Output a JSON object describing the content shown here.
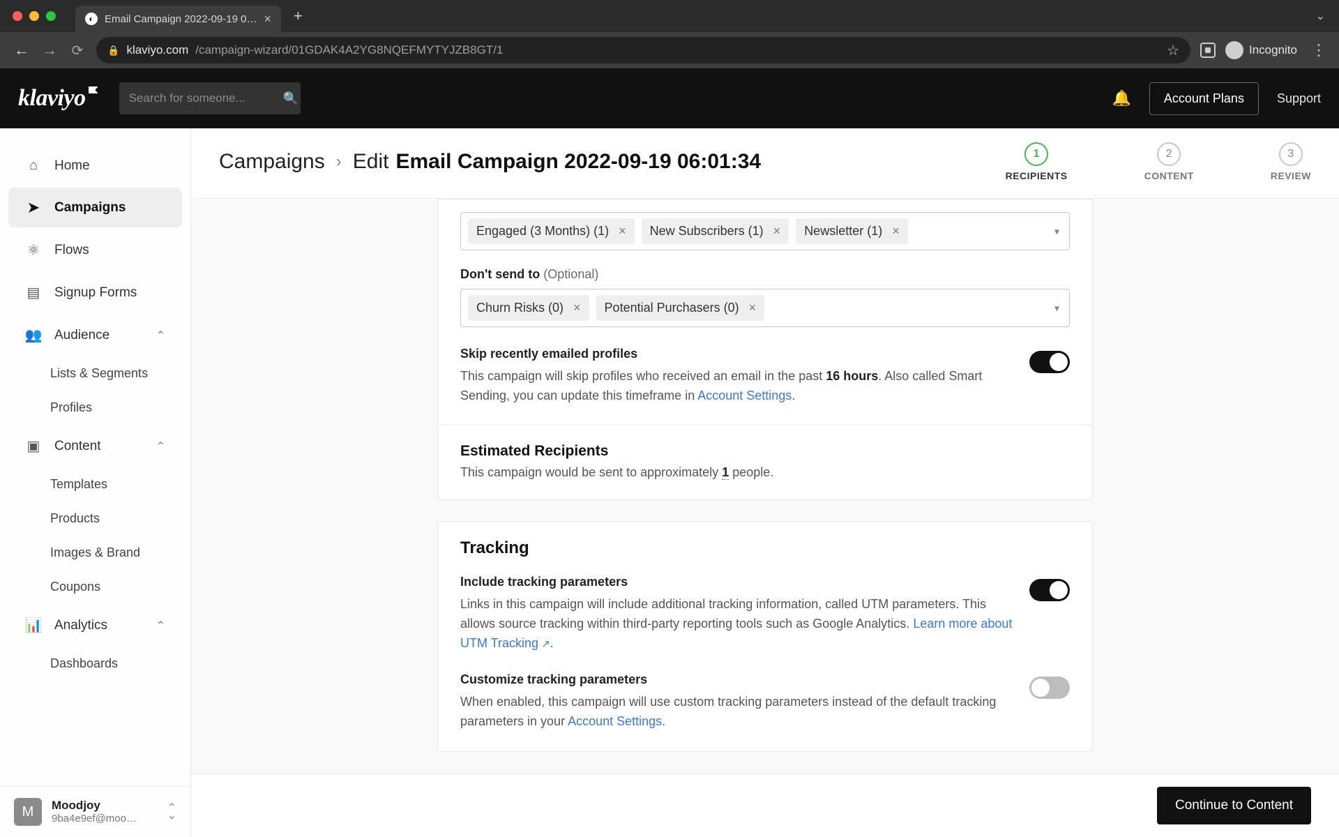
{
  "browser": {
    "tab_title": "Email Campaign 2022-09-19 0…",
    "url_host": "klaviyo.com",
    "url_path": "/campaign-wizard/01GDAK4A2YG8NQEFMYTYJZB8GT/1",
    "incognito_label": "Incognito"
  },
  "topbar": {
    "logo_text": "klaviyo",
    "search_placeholder": "Search for someone...",
    "account_plans": "Account Plans",
    "support": "Support"
  },
  "sidebar": {
    "items": {
      "home": "Home",
      "campaigns": "Campaigns",
      "flows": "Flows",
      "signup_forms": "Signup Forms",
      "audience": "Audience",
      "lists_segments": "Lists & Segments",
      "profiles": "Profiles",
      "content": "Content",
      "templates": "Templates",
      "products": "Products",
      "images_brand": "Images & Brand",
      "coupons": "Coupons",
      "analytics": "Analytics",
      "dashboards": "Dashboards"
    },
    "footer": {
      "avatar_initial": "M",
      "name": "Moodjoy",
      "email": "9ba4e9ef@moo…"
    }
  },
  "header": {
    "crumb_root": "Campaigns",
    "crumb_action": "Edit",
    "crumb_title": "Email Campaign 2022-09-19 06:01:34",
    "steps": [
      {
        "n": "1",
        "label": "RECIPIENTS"
      },
      {
        "n": "2",
        "label": "CONTENT"
      },
      {
        "n": "3",
        "label": "REVIEW"
      }
    ]
  },
  "recipients": {
    "send_to_chips": [
      "Engaged (3 Months) (1)",
      "New Subscribers (1)",
      "Newsletter (1)"
    ],
    "dont_send_label": "Don't send to",
    "dont_send_optional": "(Optional)",
    "dont_send_chips": [
      "Churn Risks (0)",
      "Potential Purchasers (0)"
    ],
    "skip_heading": "Skip recently emailed profiles",
    "skip_body_pre": "This campaign will skip profiles who received an email in the past ",
    "skip_hours": "16 hours",
    "skip_body_post1": ". Also called Smart Sending, you can update this timeframe in ",
    "skip_link": "Account Settings",
    "skip_body_post2": ".",
    "estimate_heading": "Estimated Recipients",
    "estimate_pre": "This campaign would be sent to approximately ",
    "estimate_count": "1",
    "estimate_post": " people."
  },
  "tracking": {
    "title": "Tracking",
    "include_h": "Include tracking parameters",
    "include_body_pre": "Links in this campaign will include additional tracking information, called UTM parameters. This allows source tracking within third-party reporting tools such as Google Analytics. ",
    "include_link": "Learn more about UTM Tracking",
    "include_body_post": ".",
    "customize_h": "Customize tracking parameters",
    "customize_body_pre": "When enabled, this campaign will use custom tracking parameters instead of the default tracking parameters in your ",
    "customize_link": "Account Settings",
    "customize_body_post": "."
  },
  "footer": {
    "cta": "Continue to Content"
  }
}
